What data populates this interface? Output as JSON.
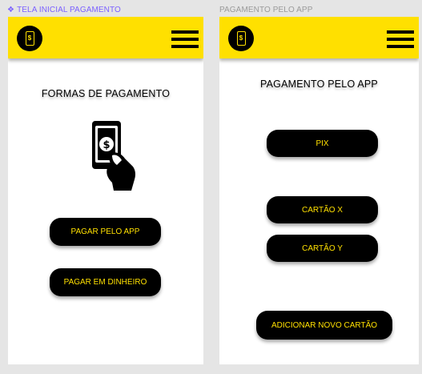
{
  "frames": {
    "left_label": "TELA INICIAL PAGAMENTO",
    "right_label": "PAGAMENTO PELO APP"
  },
  "icons": {
    "logo": "phone-dollar-icon",
    "menu": "hamburger-menu-icon",
    "illustration": "hand-holding-phone-dollar-icon",
    "frame_marker": "component-diamond-icon"
  },
  "colors": {
    "brand_yellow": "#ffe000",
    "button_black": "#000000",
    "frame_label_purple": "#7b61ff"
  },
  "left_screen": {
    "title": "FORMAS DE PAGAMENTO",
    "buttons": [
      "PAGAR PELO APP",
      "PAGAR EM DINHEIRO"
    ]
  },
  "right_screen": {
    "title": "PAGAMENTO PELO APP",
    "buttons": [
      "PIX",
      "CARTÃO X",
      "CARTÃO Y",
      "ADICIONAR NOVO CARTÃO"
    ]
  }
}
